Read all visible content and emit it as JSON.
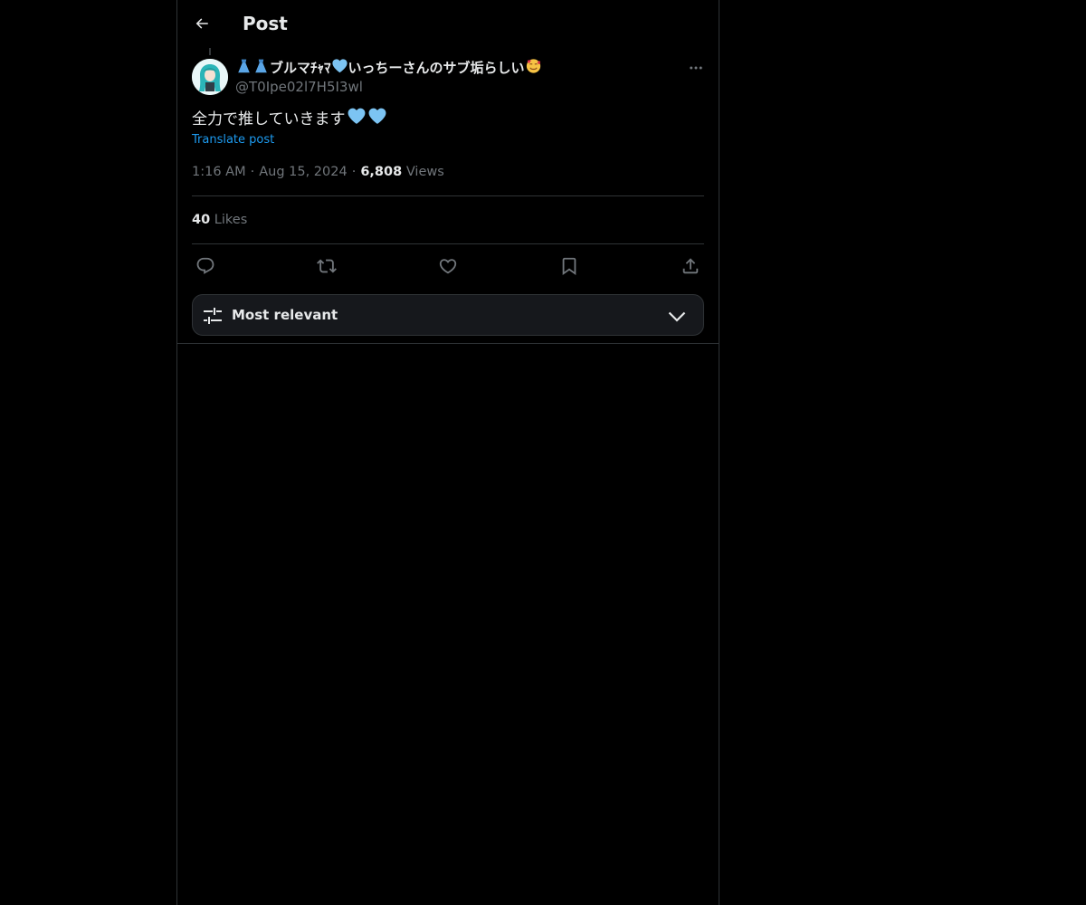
{
  "header": {
    "title": "Post",
    "back_icon": "arrow-left-icon"
  },
  "author": {
    "display_name_prefix": "",
    "display_name_katakana": "ブルマﾁｬﾏ",
    "display_name_mid": "いっちーさんのサブ垢らしい",
    "handle": "@T0Ipe02l7H5I3wl",
    "avatar_icon": "avatar-image"
  },
  "post": {
    "text": "全力で推していきます",
    "translate_label": "Translate post",
    "time": "1:16 AM",
    "date": "Aug 15, 2024",
    "views_count": "6,808",
    "views_label": "Views",
    "likes_count": "40",
    "likes_label": "Likes"
  },
  "actions": [
    {
      "name": "reply",
      "icon": "reply-icon"
    },
    {
      "name": "repost",
      "icon": "repost-icon"
    },
    {
      "name": "like",
      "icon": "heart-icon"
    },
    {
      "name": "bookmark",
      "icon": "bookmark-icon"
    },
    {
      "name": "share",
      "icon": "share-icon"
    }
  ],
  "sort": {
    "label": "Most relevant",
    "icon": "sliders-icon",
    "chevron": "chevron-down-icon"
  },
  "colors": {
    "background": "#000000",
    "text": "#e7e9ea",
    "secondary": "#71767b",
    "link": "#1d9bf0",
    "border": "#2f3336",
    "heart_emoji": "#7cc4f3"
  }
}
